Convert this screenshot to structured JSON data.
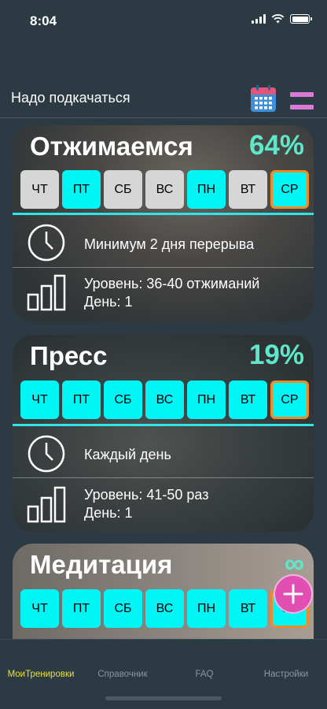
{
  "status_bar": {
    "time": "8:04"
  },
  "header": {
    "title": "Надо подкачаться"
  },
  "cards": [
    {
      "title": "Отжимаемся",
      "percent": "64%",
      "days": [
        {
          "label": "ЧТ",
          "state": "off"
        },
        {
          "label": "ПТ",
          "state": "on"
        },
        {
          "label": "СБ",
          "state": "off"
        },
        {
          "label": "ВС",
          "state": "off"
        },
        {
          "label": "ПН",
          "state": "on"
        },
        {
          "label": "ВТ",
          "state": "off"
        },
        {
          "label": "СР",
          "state": "today"
        }
      ],
      "rest": "Минимум 2 дня перерыва",
      "level": "Уровень: 36-40 отжиманий",
      "day": "День: 1"
    },
    {
      "title": "Пресс",
      "percent": "19%",
      "days": [
        {
          "label": "ЧТ",
          "state": "on"
        },
        {
          "label": "ПТ",
          "state": "on"
        },
        {
          "label": "СБ",
          "state": "on"
        },
        {
          "label": "ВС",
          "state": "on"
        },
        {
          "label": "ПН",
          "state": "on"
        },
        {
          "label": "ВТ",
          "state": "on"
        },
        {
          "label": "СР",
          "state": "today"
        }
      ],
      "rest": "Каждый день",
      "level": "Уровень: 41-50 раз",
      "day": "День: 1"
    },
    {
      "title": "Медитация",
      "percent": "∞",
      "days": [
        {
          "label": "ЧТ",
          "state": "on"
        },
        {
          "label": "ПТ",
          "state": "on"
        },
        {
          "label": "СБ",
          "state": "on"
        },
        {
          "label": "ВС",
          "state": "on"
        },
        {
          "label": "ПН",
          "state": "on"
        },
        {
          "label": "ВТ",
          "state": "on"
        },
        {
          "label": "СР",
          "state": "today"
        }
      ]
    }
  ],
  "tabs": [
    {
      "label": "МоиТренировки",
      "active": true
    },
    {
      "label": "Справочник",
      "active": false
    },
    {
      "label": "FAQ",
      "active": false
    },
    {
      "label": "Настройки",
      "active": false
    }
  ],
  "colors": {
    "background": "#2c3a44",
    "accent_cyan": "#00f5f5",
    "percent_green": "#5ee7c8",
    "today_border": "#f08b28",
    "fab_pink": "#e04fb1",
    "menu_pink": "#d77ad6",
    "tab_active": "#e8e23a"
  }
}
